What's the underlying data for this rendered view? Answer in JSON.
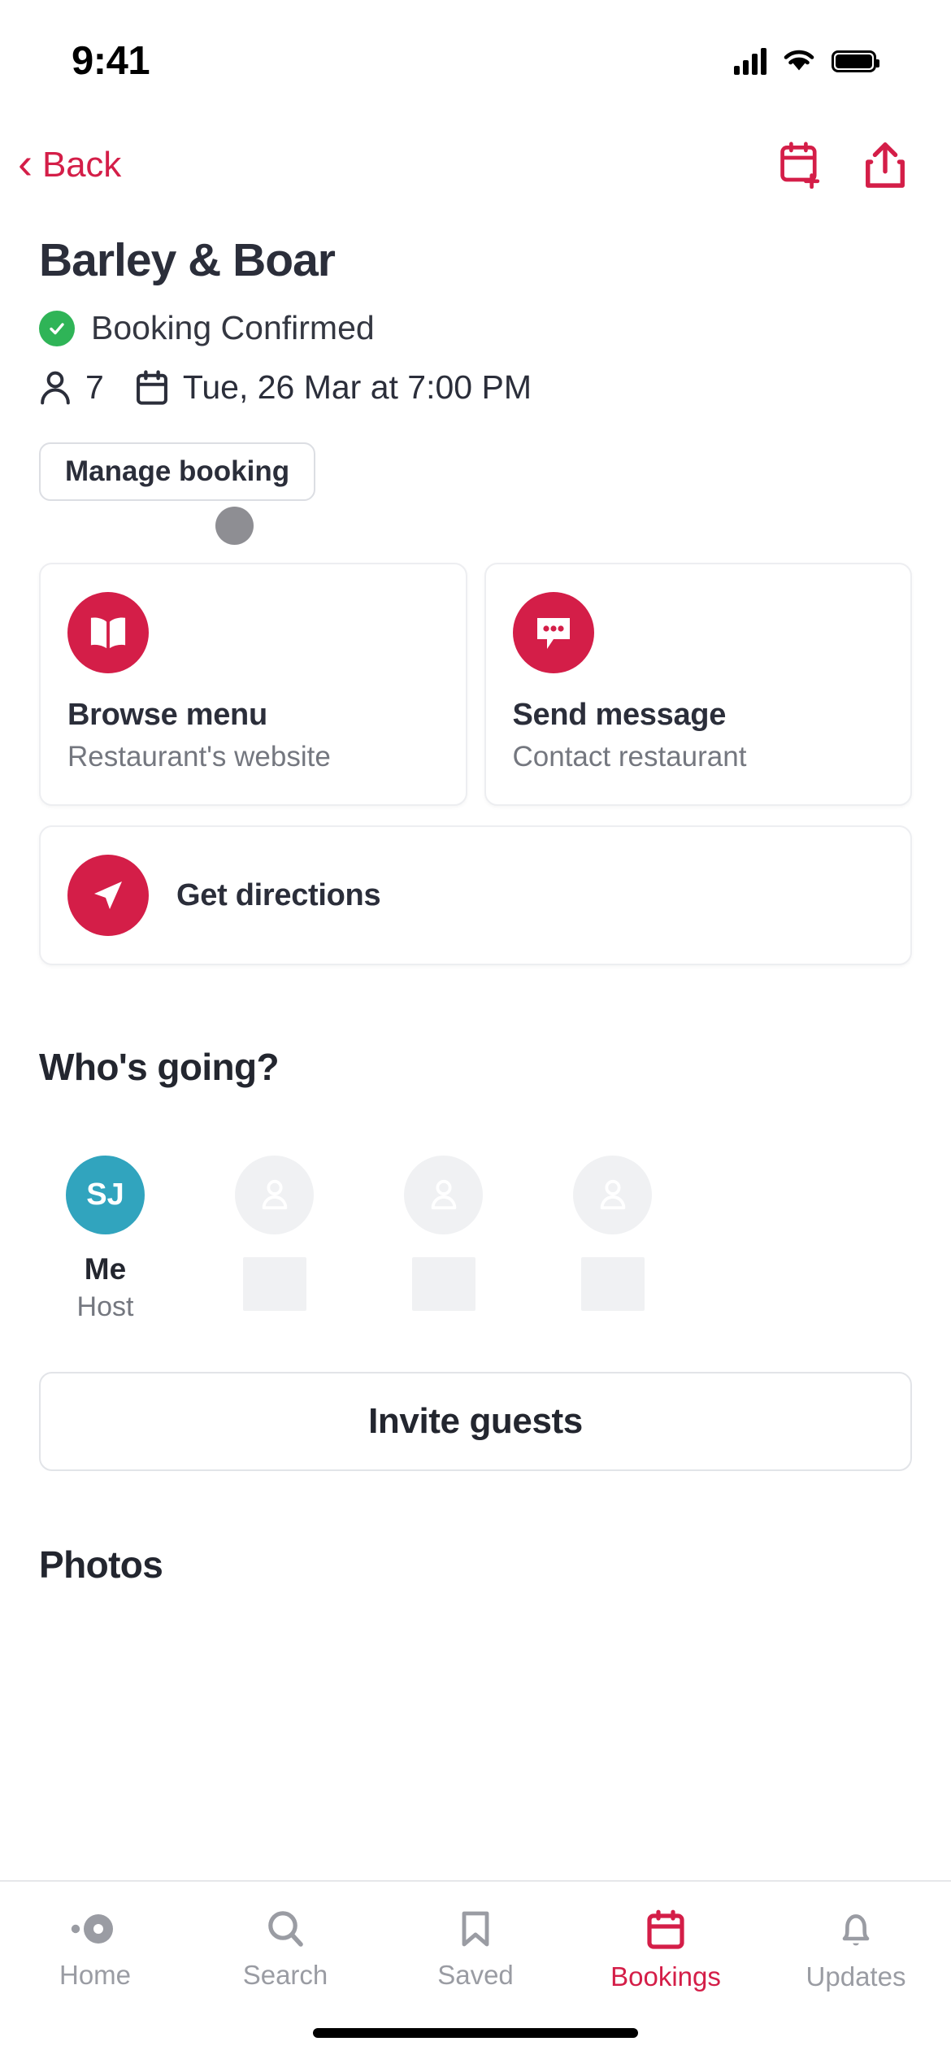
{
  "status_bar": {
    "time": "9:41",
    "icons": [
      "cellular-signal-icon",
      "wifi-icon",
      "battery-icon"
    ]
  },
  "nav": {
    "back_label": "Back",
    "back_icon": "chevron-left-icon",
    "add_to_calendar_icon": "calendar-add-icon",
    "share_icon": "share-icon",
    "accent_color": "#D41E48"
  },
  "booking": {
    "restaurant_name": "Barley & Boar",
    "status_text": "Booking Confirmed",
    "status_color": "#2FB457",
    "party_size": "7",
    "date_time": "Tue, 26 Mar at 7:00 PM",
    "manage_label": "Manage booking"
  },
  "actions": [
    {
      "title": "Browse menu",
      "subtitle": "Restaurant's website",
      "icon": "book-icon"
    },
    {
      "title": "Send message",
      "subtitle": "Contact restaurant",
      "icon": "chat-bubble-icon"
    }
  ],
  "directions": {
    "title": "Get directions",
    "icon": "navigation-arrow-icon"
  },
  "guests_section": {
    "heading": "Who's going?",
    "guests": [
      {
        "initials": "SJ",
        "name": "Me",
        "role": "Host",
        "avatar_color": "#31A4BE"
      },
      {
        "initials": "",
        "name": "",
        "role": "",
        "avatar_color": "#F0F1F3"
      },
      {
        "initials": "",
        "name": "",
        "role": "",
        "avatar_color": "#F0F1F3"
      },
      {
        "initials": "",
        "name": "",
        "role": "",
        "avatar_color": "#F0F1F3"
      }
    ],
    "invite_label": "Invite guests"
  },
  "photos_section": {
    "heading": "Photos"
  },
  "tab_bar": {
    "tabs": [
      {
        "label": "Home",
        "icon": "home-icon",
        "active": false
      },
      {
        "label": "Search",
        "icon": "search-icon",
        "active": false
      },
      {
        "label": "Saved",
        "icon": "bookmark-icon",
        "active": false
      },
      {
        "label": "Bookings",
        "icon": "calendar-icon",
        "active": true
      },
      {
        "label": "Updates",
        "icon": "bell-icon",
        "active": false
      }
    ],
    "active_color": "#D41E48",
    "inactive_color": "#9A9CA3"
  }
}
